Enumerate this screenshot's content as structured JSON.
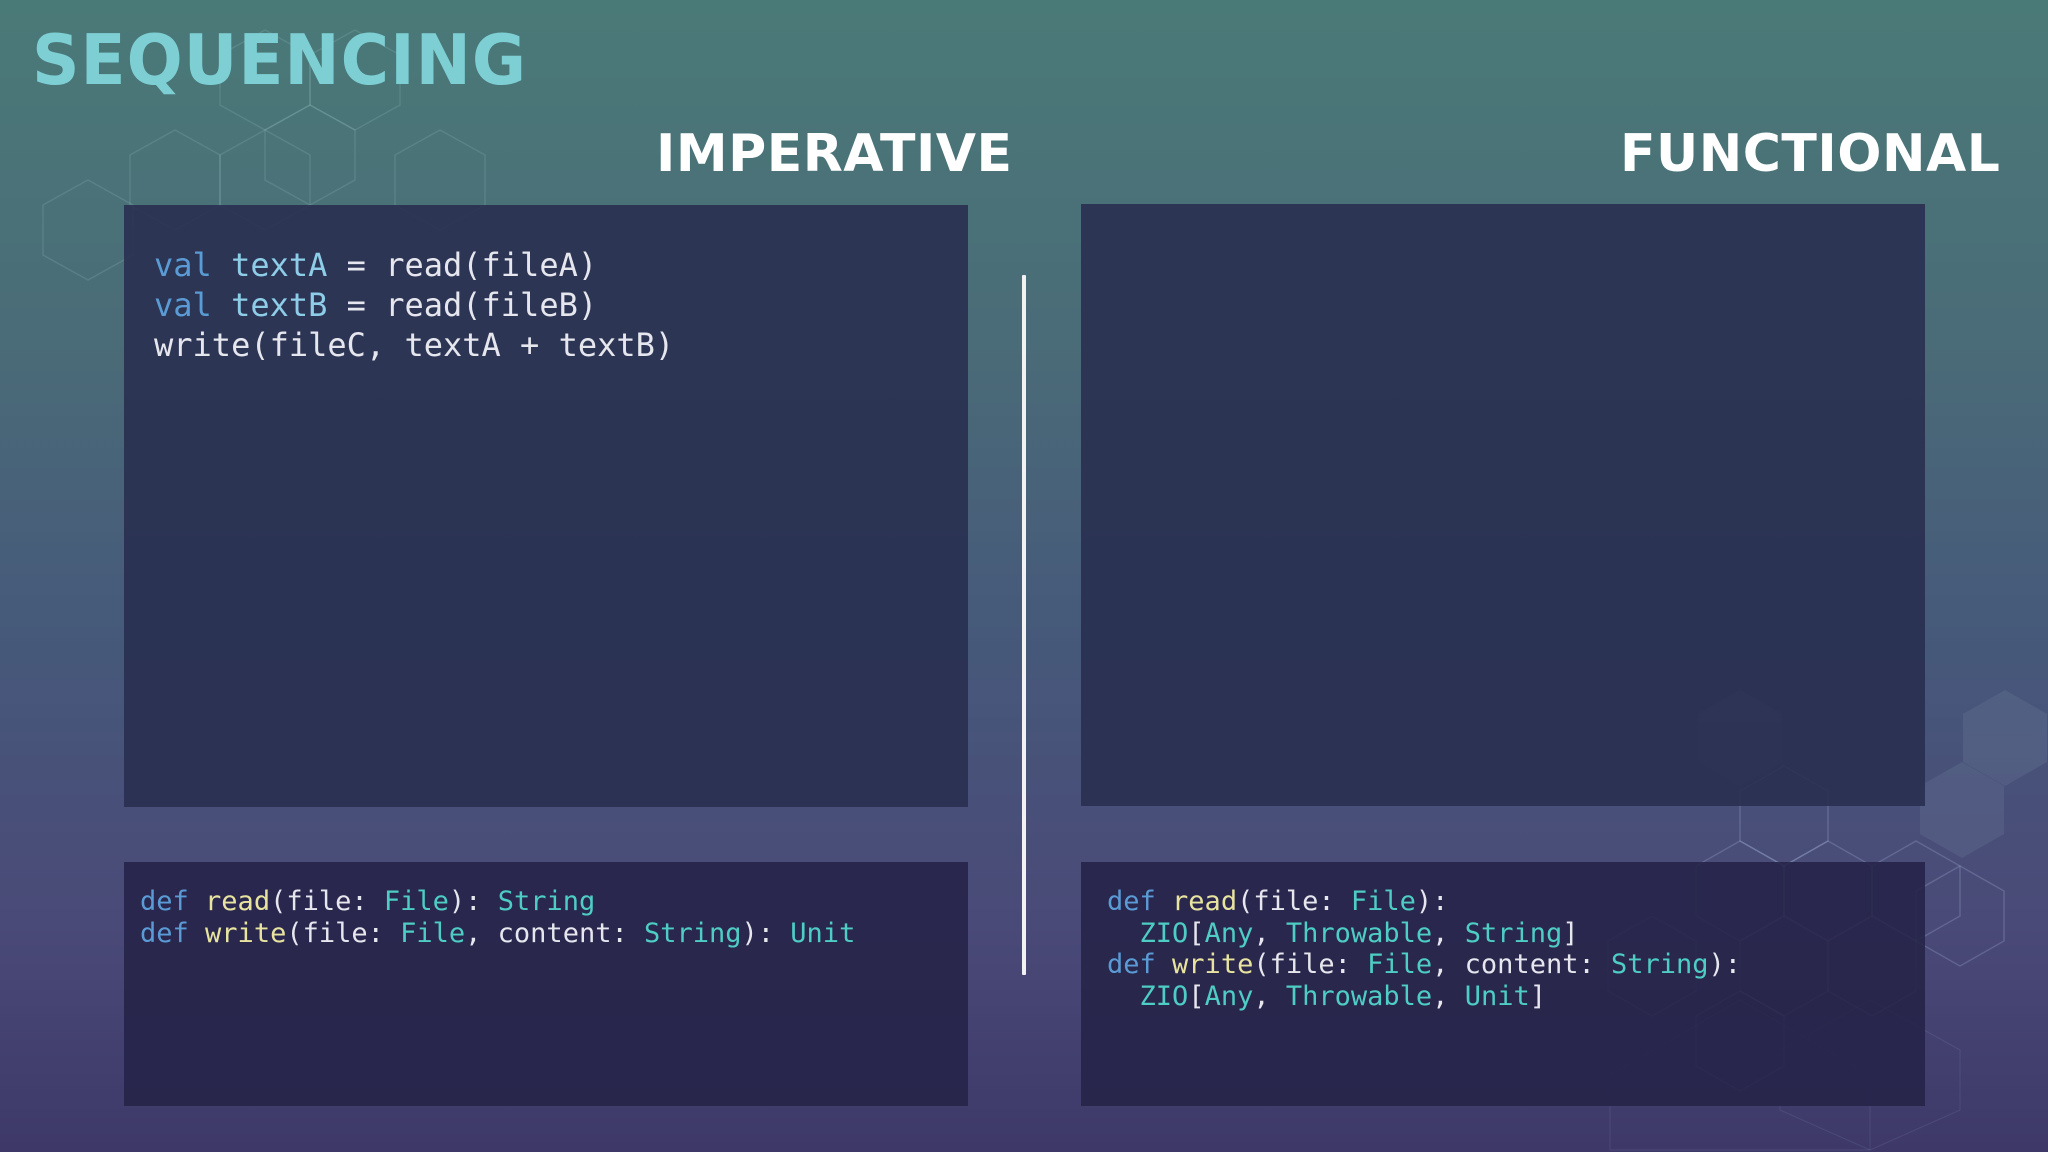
{
  "slide": {
    "title": "SEQUENCING",
    "imperative_heading": "IMPERATIVE",
    "functional_heading": "FUNCTIONAL"
  },
  "colors": {
    "title": "#7ecfd4",
    "keyword": "#5b9bd5",
    "identifier": "#8ecde8",
    "function_name": "#e8e4a0",
    "type": "#4ecdc4",
    "plain": "#e6e6ee",
    "panel": "#282e4e"
  },
  "imperative_code": {
    "line1": {
      "kw": "val",
      "name": "textA",
      "rest": " = read(fileA)"
    },
    "line2": {
      "kw": "val",
      "name": "textB",
      "rest": " = read(fileB)"
    },
    "line3": {
      "text": "write(fileC, textA + textB)"
    }
  },
  "imperative_sigs": {
    "read": {
      "kw": "def",
      "fn": "read",
      "p1": "(file: ",
      "t1": "File",
      "p2": "): ",
      "t2": "String"
    },
    "write": {
      "kw": "def",
      "fn": "write",
      "p1": "(file: ",
      "t1": "File",
      "p2": ", content: ",
      "t2": "String",
      "p3": "): ",
      "t3": "Unit"
    }
  },
  "functional_sigs": {
    "read_line1": {
      "kw": "def",
      "fn": "read",
      "p1": "(file: ",
      "t1": "File",
      "p2": "):"
    },
    "read_line2": {
      "indent": "  ",
      "t1": "ZIO",
      "p1": "[",
      "t2": "Any",
      "p2": ", ",
      "t3": "Throwable",
      "p3": ", ",
      "t4": "String",
      "p4": "]"
    },
    "write_line1": {
      "kw": "def",
      "fn": "write",
      "p1": "(file: ",
      "t1": "File",
      "p2": ", content: ",
      "t2": "String",
      "p3": "):"
    },
    "write_line2": {
      "indent": "  ",
      "t1": "ZIO",
      "p1": "[",
      "t2": "Any",
      "p2": ", ",
      "t3": "Throwable",
      "p3": ", ",
      "t4": "Unit",
      "p4": "]"
    }
  }
}
